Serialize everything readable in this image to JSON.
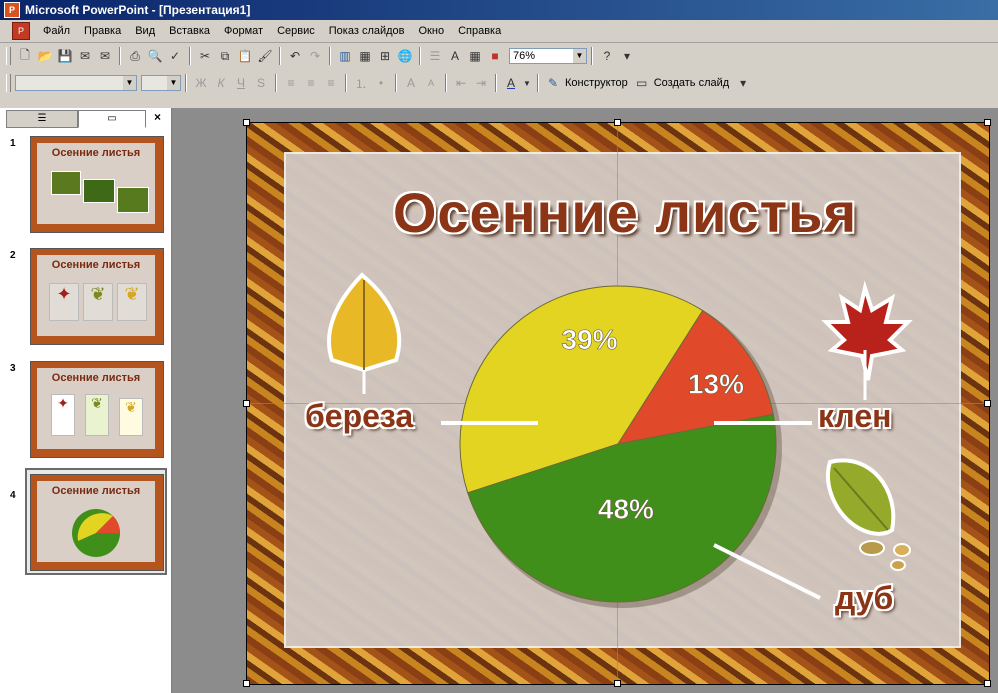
{
  "window": {
    "title": "Microsoft PowerPoint - [Презентация1]"
  },
  "menu": [
    "Файл",
    "Правка",
    "Вид",
    "Вставка",
    "Формат",
    "Сервис",
    "Показ слайдов",
    "Окно",
    "Справка"
  ],
  "toolbar": {
    "zoom": "76%",
    "designer_label": "Конструктор",
    "new_slide_label": "Создать слайд"
  },
  "thumbnails": {
    "items": [
      {
        "number": "1",
        "title": "Осенние листья"
      },
      {
        "number": "2",
        "title": "Осенние листья"
      },
      {
        "number": "3",
        "title": "Осенние листья"
      },
      {
        "number": "4",
        "title": "Осенние листья"
      }
    ],
    "selected": "4"
  },
  "slide": {
    "title": "Осенние листья",
    "labels": {
      "birch": "береза",
      "maple": "клен",
      "oak": "дуб"
    }
  },
  "chart_data": {
    "type": "pie",
    "categories": [
      "береза",
      "клен",
      "дуб"
    ],
    "values": [
      39,
      13,
      48
    ],
    "value_labels": [
      "39%",
      "13%",
      "48%"
    ],
    "colors": [
      "#e2d421",
      "#e0492a",
      "#3f8f1a"
    ],
    "title": "Осенние листья"
  }
}
